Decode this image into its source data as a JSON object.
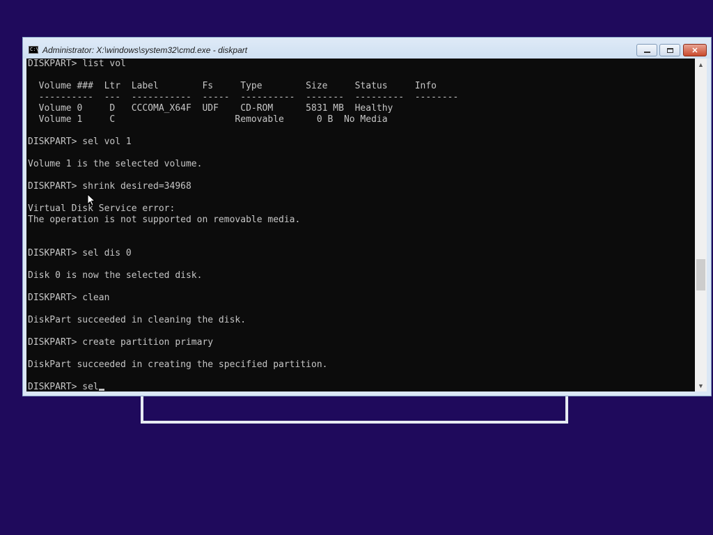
{
  "window": {
    "title": "Administrator: X:\\windows\\system32\\cmd.exe - diskpart",
    "icon_label": "C:\\",
    "icons": {
      "app": "cmd-icon",
      "minimize": "minimize-icon",
      "maximize": "maximize-icon",
      "close": "close-icon"
    }
  },
  "console": {
    "lines": [
      "DISKPART> list vol",
      "",
      "  Volume ###  Ltr  Label        Fs     Type        Size     Status     Info",
      "  ----------  ---  -----------  -----  ----------  -------  ---------  --------",
      "  Volume 0     D   CCCOMA_X64F  UDF    CD-ROM      5831 MB  Healthy",
      "  Volume 1     C                      Removable      0 B  No Media",
      "",
      "DISKPART> sel vol 1",
      "",
      "Volume 1 is the selected volume.",
      "",
      "DISKPART> shrink desired=34968",
      "",
      "Virtual Disk Service error:",
      "The operation is not supported on removable media.",
      "",
      "",
      "DISKPART> sel dis 0",
      "",
      "Disk 0 is now the selected disk.",
      "",
      "DISKPART> clean",
      "",
      "DiskPart succeeded in cleaning the disk.",
      "",
      "DISKPART> create partition primary",
      "",
      "DiskPart succeeded in creating the specified partition.",
      "",
      "DISKPART> sel"
    ]
  },
  "colors": {
    "desktop_bg": "#1f0a5c",
    "console_bg": "#0c0c0c",
    "console_text": "#c6c6c6",
    "close_button": "#c94a2d"
  }
}
